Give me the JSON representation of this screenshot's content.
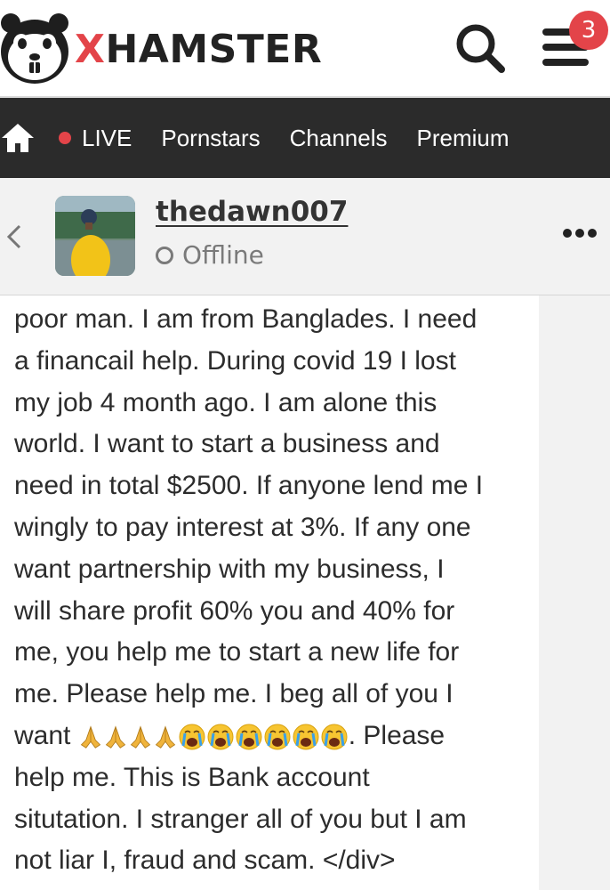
{
  "header": {
    "logo_text": "XHAMSTER",
    "logo_icon": "hamster-face-icon",
    "search_icon": "search-icon",
    "menu_icon": "hamburger-menu-icon",
    "notification_count": "3"
  },
  "nav": {
    "home_icon": "home-icon",
    "items": [
      {
        "label": "LIVE"
      },
      {
        "label": "Pornstars"
      },
      {
        "label": "Channels"
      },
      {
        "label": "Premium"
      }
    ]
  },
  "profile": {
    "back_icon": "chevron-left-icon",
    "username": "thedawn007",
    "status": "Offline",
    "more_icon": "more-horizontal-icon"
  },
  "message": {
    "lines": [
      "poor man. I am from Banglades. I need",
      "a financail help. During covid 19 I lost",
      "my job 4 month ago. I am alone this",
      "world. I want to start a business and",
      "need in total $2500. If anyone lend me I",
      "wingly to pay interest at 3%. If any one",
      "want partnership with my business, I",
      "will share profit 60% you and 40% for",
      "me, you help me to start a new life for",
      "me. Please help me. I beg all of you I",
      "want",
      ". Please",
      "help me. This is Bank account",
      "situtation. I stranger all of you but I am",
      "not liar I, fraud and scam. </div>"
    ],
    "emoji_sequence": [
      "folded-hands",
      "folded-hands",
      "folded-hands",
      "folded-hands",
      "crying-face",
      "crying-face",
      "crying-face",
      "crying-face",
      "crying-face",
      "crying-face"
    ]
  },
  "colors": {
    "brand_red": "#e34449",
    "nav_bg": "#2b2b2b",
    "profile_bg": "#f2f2f2",
    "text": "#2c2c2c"
  }
}
